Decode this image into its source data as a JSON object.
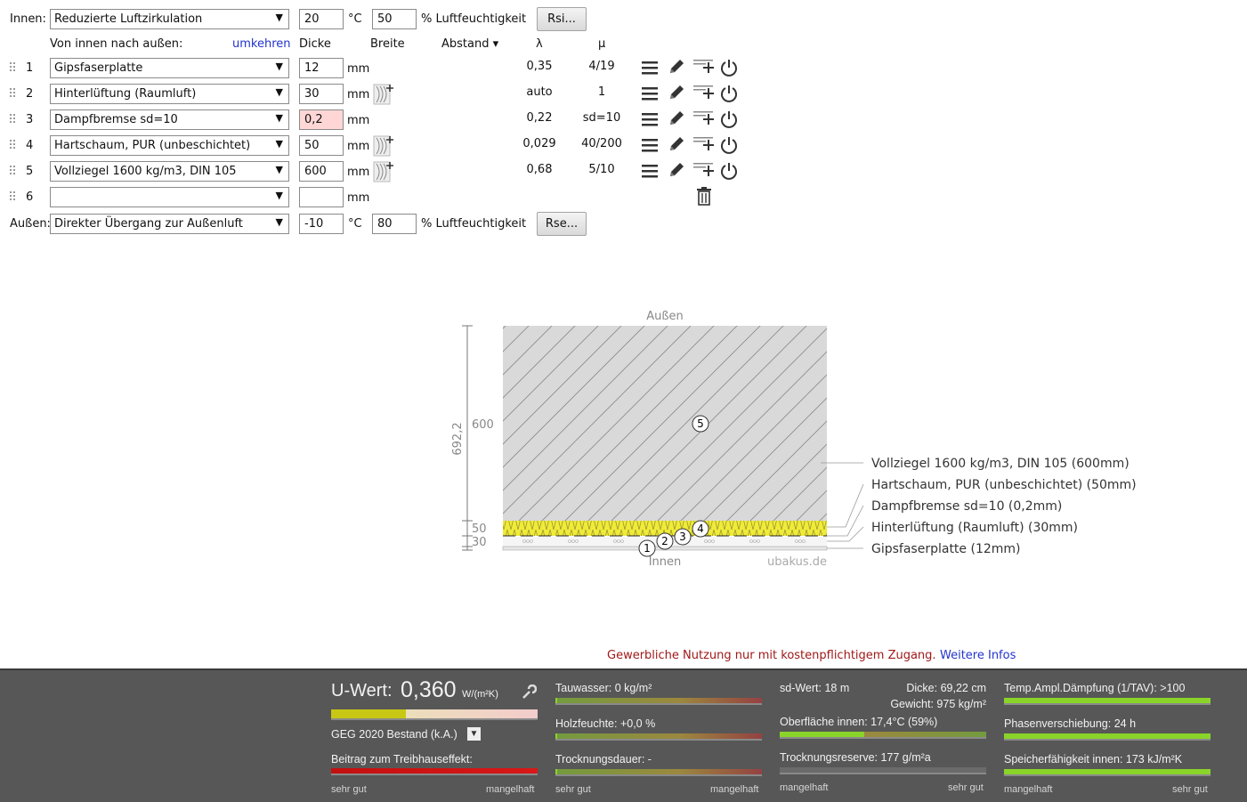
{
  "header": {
    "innen_label": "Innen:",
    "innen_select": "Reduzierte Luftzirkulation",
    "innen_temp": "20",
    "temp_unit": "°C",
    "innen_humidity": "50",
    "humidity_label": "% Luftfeuchtigkeit",
    "rsi_button": "Rsi...",
    "aussen_label": "Außen:",
    "aussen_select": "Direkter Übergang zur Außenluft",
    "aussen_temp": "-10",
    "aussen_humidity": "80",
    "rse_button": "Rse..."
  },
  "columns": {
    "direction": "Von innen nach außen:",
    "reverse": "umkehren",
    "thickness": "Dicke",
    "width": "Breite",
    "spacing": "Abstand ▾",
    "lambda": "λ",
    "mu": "μ"
  },
  "unit_mm": "mm",
  "layers": [
    {
      "num": "1",
      "material": "Gipsfaserplatte",
      "thickness": "12",
      "lambda": "0,35",
      "mu": "4/19",
      "width_icon": false
    },
    {
      "num": "2",
      "material": "Hinterlüftung (Raumluft)",
      "thickness": "30",
      "lambda": "auto",
      "mu": "1",
      "width_icon": true
    },
    {
      "num": "3",
      "material": "Dampfbremse sd=10",
      "thickness": "0,2",
      "lambda": "0,22",
      "mu": "sd=10",
      "width_icon": false,
      "error": true
    },
    {
      "num": "4",
      "material": "Hartschaum, PUR (unbeschichtet)",
      "thickness": "50",
      "lambda": "0,029",
      "mu": "40/200",
      "width_icon": true
    },
    {
      "num": "5",
      "material": "Vollziegel 1600 kg/m3, DIN 105",
      "thickness": "600",
      "lambda": "0,68",
      "mu": "5/10",
      "width_icon": true
    },
    {
      "num": "6",
      "material": "",
      "thickness": "",
      "lambda": "",
      "mu": "",
      "width_icon": false
    }
  ],
  "diagram": {
    "top_label": "Außen",
    "bottom_label": "Innen",
    "watermark": "ubakus.de",
    "total_dim": "692,2",
    "dims": [
      "600",
      "50",
      "30"
    ],
    "legend": [
      "Vollziegel 1600 kg/m3, DIN 105 (600mm)",
      "Hartschaum, PUR (unbeschichtet) (50mm)",
      "Dampfbremse sd=10 (0,2mm)",
      "Hinterlüftung (Raumluft) (30mm)",
      "Gipsfaserplatte (12mm)"
    ],
    "markers": [
      "1",
      "2",
      "3",
      "4",
      "5"
    ]
  },
  "notice": {
    "text": "Gewerbliche Nutzung nur mit kostenpflichtigem Zugang.",
    "link": "Weitere Infos"
  },
  "footer": {
    "uwert_label": "U-Wert:",
    "uwert_value": "0,360",
    "uwert_unit": "W/(m²K)",
    "uwert_fill": 0.36,
    "geg": "GEG 2020 Bestand (k.A.)",
    "treibhaus": "Beitrag zum Treibhauseffekt:",
    "tauwasser": "Tauwasser: 0 kg/m²",
    "holzfeuchte": "Holzfeuchte: +0,0 %",
    "trocknungsdauer": "Trocknungsdauer: -",
    "sd_wert": "sd-Wert: 18 m",
    "dicke": "Dicke: 69,22 cm",
    "gewicht": "Gewicht: 975 kg/m²",
    "oberflaeche": "Oberfläche innen: 17,4°C (59%)",
    "oberflaeche_fill": 0.41,
    "trocknungsreserve": "Trocknungsreserve: 177 g/m²a",
    "daempfung": "Temp.Ampl.Dämpfung (1/TAV): >100",
    "phasen": "Phasenverschiebung: 24 h",
    "speicher": "Speicherfähigkeit innen: 173 kJ/m²K",
    "sehr_gut": "sehr gut",
    "mangelhaft": "mangelhaft",
    "colors": {
      "good": "#8ad42a",
      "bad": "#d11a1a",
      "mid": "#d4c41a"
    }
  }
}
